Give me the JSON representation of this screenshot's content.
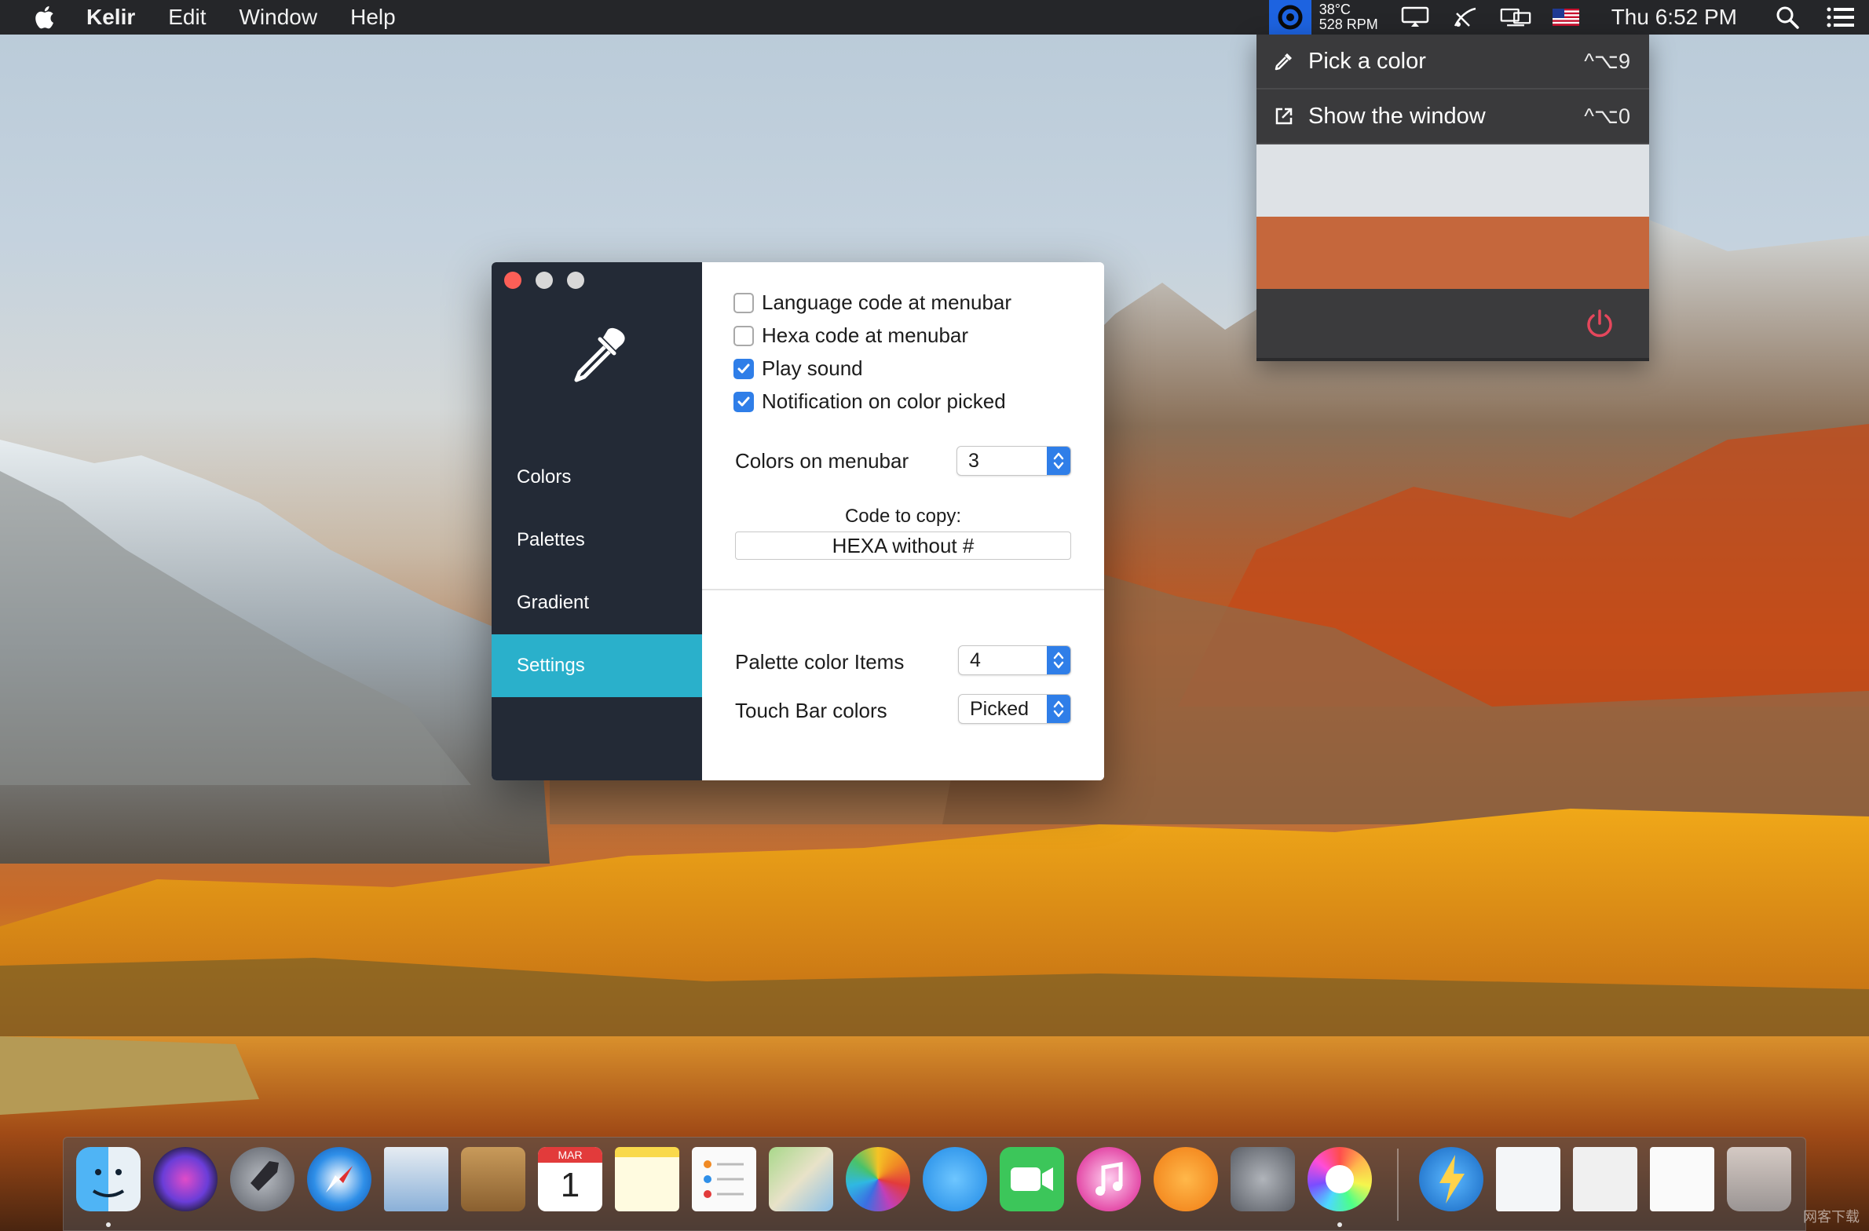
{
  "menubar": {
    "app_name": "Kelir",
    "menus": [
      "Edit",
      "Window",
      "Help"
    ],
    "status": {
      "temperature": "38°C",
      "fan_rpm": "528 RPM",
      "clock": "Thu 6:52 PM"
    }
  },
  "dropdown": {
    "items": [
      {
        "label": "Pick a color",
        "shortcut": "^⌥9",
        "icon": "eyedropper-icon"
      },
      {
        "label": "Show the window",
        "shortcut": "^⌥0",
        "icon": "external-window-icon"
      }
    ],
    "recent_colors": [
      "#dee2e6",
      "#c5673c",
      "#3b3b3d"
    ],
    "power_color": "#e5475c"
  },
  "window": {
    "sidebar": {
      "items": [
        {
          "label": "Colors"
        },
        {
          "label": "Palettes"
        },
        {
          "label": "Gradient"
        },
        {
          "label": "Settings",
          "active": true
        }
      ],
      "accent": "#2ab0cb",
      "background": "#232a36"
    },
    "settings": {
      "checkboxes": [
        {
          "label": "Language code at menubar",
          "checked": false
        },
        {
          "label": "Hexa code at menubar",
          "checked": false
        },
        {
          "label": "Play sound",
          "checked": true
        },
        {
          "label": "Notification on color picked",
          "checked": true
        }
      ],
      "colors_on_menubar": {
        "label": "Colors on menubar",
        "value": "3"
      },
      "code_to_copy": {
        "label": "Code to copy:",
        "value": "HEXA without #"
      },
      "palette_items": {
        "label": "Palette color Items",
        "value": "4"
      },
      "touchbar_colors": {
        "label": "Touch Bar colors",
        "value": "Picked"
      }
    }
  },
  "dock": {
    "apps": [
      "Finder",
      "Siri",
      "Launchpad",
      "Safari",
      "Mail",
      "Contacts",
      "Calendar",
      "Notes",
      "Reminders",
      "Maps",
      "Photos",
      "Messages",
      "FaceTime",
      "iTunes",
      "iBooks",
      "System Preferences",
      "Kelir",
      "Downloads",
      "Document",
      "Screenshot",
      "Calendar Sheet",
      "Trash"
    ],
    "calendar_month": "MAR",
    "calendar_day": "1"
  },
  "watermark": "网客下载"
}
